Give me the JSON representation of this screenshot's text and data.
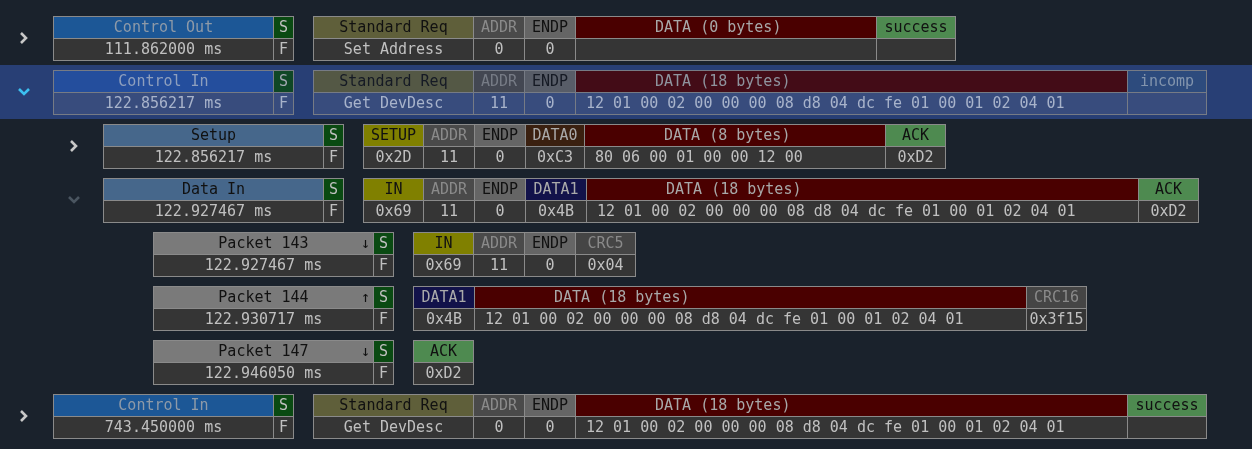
{
  "transactions": [
    {
      "name": "Control Out",
      "time": "111.862000 ms",
      "s_flag": "S",
      "f_flag": "F",
      "kind": "control_out",
      "expanded": false,
      "selected": false,
      "fields": [
        {
          "kind": "request",
          "label": "Standard Req",
          "value": "Set Address"
        },
        {
          "kind": "addr",
          "label": "ADDR",
          "value": "0"
        },
        {
          "kind": "endp",
          "label": "ENDP",
          "value": "0"
        },
        {
          "kind": "data",
          "label": "DATA (0 bytes)"
        },
        {
          "kind": "status_ok",
          "label": "success"
        }
      ]
    },
    {
      "name": "Control In",
      "time": "122.856217 ms",
      "s_flag": "S",
      "f_flag": "F",
      "kind": "control_in",
      "expanded": true,
      "selected": true,
      "fields": [
        {
          "kind": "request",
          "label": "Standard Req",
          "value": "Get DevDesc"
        },
        {
          "kind": "addr",
          "label": "ADDR",
          "value": "11"
        },
        {
          "kind": "endp",
          "label": "ENDP",
          "value": "0"
        },
        {
          "kind": "data",
          "label": "DATA (18 bytes)",
          "value": "12 01 00 02 00 00 00 08 d8 04 dc fe 01 00 01 02 04 01"
        },
        {
          "kind": "status_incomplete",
          "label": "incomp"
        }
      ],
      "children": [
        {
          "name": "Setup",
          "time": "122.856217 ms",
          "s_flag": "S",
          "f_flag": "F",
          "kind": "stage",
          "expanded": false,
          "selected": false,
          "fields": [
            {
              "kind": "pid_token",
              "label": "SETUP",
              "value": "0x2D"
            },
            {
              "kind": "addr",
              "label": "ADDR",
              "value": "11"
            },
            {
              "kind": "endp",
              "label": "ENDP",
              "value": "0"
            },
            {
              "kind": "pid_data0",
              "label": "DATA0",
              "value": "0xC3"
            },
            {
              "kind": "data",
              "label": "DATA (8 bytes)",
              "value": "80 06 00 01 00 00 12 00"
            },
            {
              "kind": "pid_handshake",
              "label": "ACK",
              "value": "0xD2"
            }
          ]
        },
        {
          "name": "Data In",
          "time": "122.927467 ms",
          "s_flag": "S",
          "f_flag": "F",
          "kind": "stage",
          "expanded": true,
          "selected": false,
          "fields": [
            {
              "kind": "pid_token",
              "label": "IN",
              "value": "0x69"
            },
            {
              "kind": "addr",
              "label": "ADDR",
              "value": "11"
            },
            {
              "kind": "endp",
              "label": "ENDP",
              "value": "0"
            },
            {
              "kind": "pid_data1",
              "label": "DATA1",
              "value": "0x4B"
            },
            {
              "kind": "data",
              "label": "DATA (18 bytes)",
              "value": "12 01 00 02 00 00 00 08 d8 04 dc fe 01 00 01 02 04 01"
            },
            {
              "kind": "pid_handshake",
              "label": "ACK",
              "value": "0xD2"
            }
          ],
          "children": [
            {
              "name": "Packet 143",
              "direction": "↓",
              "time": "122.927467 ms",
              "s_flag": "S",
              "f_flag": "F",
              "kind": "packet",
              "selected": false,
              "fields": [
                {
                  "kind": "pid_token",
                  "label": "IN",
                  "value": "0x69"
                },
                {
                  "kind": "addr",
                  "label": "ADDR",
                  "value": "11"
                },
                {
                  "kind": "endp",
                  "label": "ENDP",
                  "value": "0"
                },
                {
                  "kind": "crc",
                  "label": "CRC5",
                  "value": "0x04"
                }
              ]
            },
            {
              "name": "Packet 144",
              "direction": "↑",
              "time": "122.930717 ms",
              "s_flag": "S",
              "f_flag": "F",
              "kind": "packet",
              "selected": false,
              "fields": [
                {
                  "kind": "pid_data1",
                  "label": "DATA1",
                  "value": "0x4B"
                },
                {
                  "kind": "data",
                  "label": "DATA (18 bytes)",
                  "value": "12 01 00 02 00 00 00 08 d8 04 dc fe 01 00 01 02 04 01"
                },
                {
                  "kind": "crc",
                  "label": "CRC16",
                  "value": "0x3f15"
                }
              ]
            },
            {
              "name": "Packet 147",
              "direction": "↓",
              "time": "122.946050 ms",
              "s_flag": "S",
              "f_flag": "F",
              "kind": "packet",
              "selected": false,
              "fields": [
                {
                  "kind": "pid_handshake",
                  "label": "ACK",
                  "value": "0xD2"
                }
              ]
            }
          ]
        }
      ]
    },
    {
      "name": "Control In",
      "time": "743.450000 ms",
      "s_flag": "S",
      "f_flag": "F",
      "kind": "control_in",
      "expanded": false,
      "selected": false,
      "fields": [
        {
          "kind": "request",
          "label": "Standard Req",
          "value": "Get DevDesc"
        },
        {
          "kind": "addr",
          "label": "ADDR",
          "value": "0"
        },
        {
          "kind": "endp",
          "label": "ENDP",
          "value": "0"
        },
        {
          "kind": "data",
          "label": "DATA (18 bytes)",
          "value": "12 01 00 02 00 00 00 08 d8 04 dc fe 01 00 01 02 04 01"
        },
        {
          "kind": "status_ok",
          "label": "success"
        }
      ]
    }
  ]
}
